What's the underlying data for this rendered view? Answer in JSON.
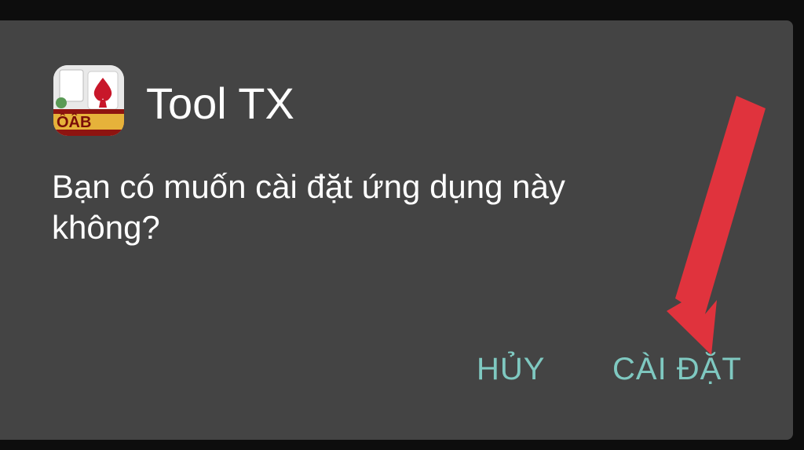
{
  "dialog": {
    "app_name": "Tool TX",
    "message": "Bạn có muốn cài đặt ứng dụng này không?",
    "cancel_label": "HỦY",
    "install_label": "CÀI ĐẶT"
  },
  "icons": {
    "app_icon": "game-app-icon",
    "annotation": "red-arrow-icon"
  },
  "colors": {
    "dialog_bg": "#444444",
    "button_text": "#7fc9c1",
    "arrow": "#e0333d"
  }
}
